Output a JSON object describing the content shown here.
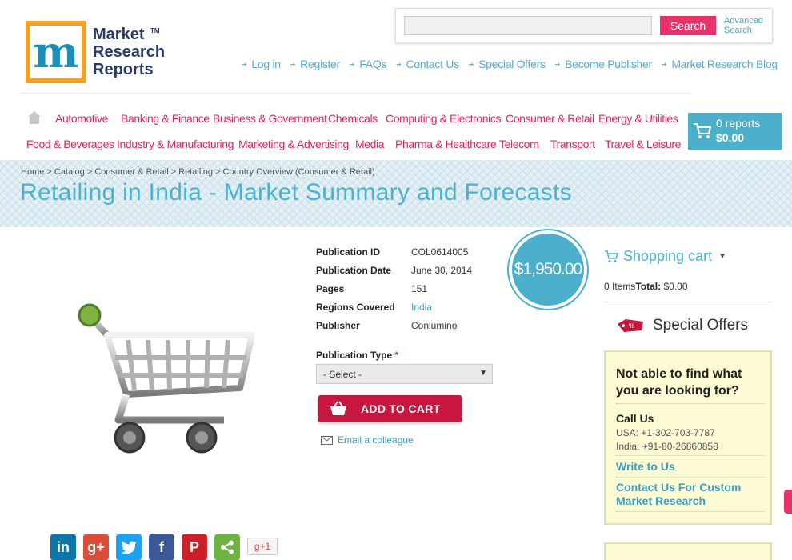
{
  "logo": {
    "lines": [
      "Market",
      "Research",
      "Reports"
    ],
    "tm": "TM"
  },
  "search": {
    "placeholder": "",
    "button": "Search",
    "advanced": [
      "Advanced",
      "Search"
    ]
  },
  "toplinks": [
    "Log in",
    "Register",
    "FAQs",
    "Contact Us",
    "Special Offers",
    "Become Publisher",
    "Market Research Blog"
  ],
  "categories_row1": [
    "Automotive",
    "Banking & Finance",
    "Business & Government",
    "Chemicals",
    "Computing & Electronics",
    "Consumer & Retail",
    "Energy & Utilities"
  ],
  "categories_row2": [
    "Food & Beverages",
    "Industry & Manufacturing",
    "Marketing & Advertising",
    "Media",
    "Pharma & Healthcare",
    "Telecom",
    "Transport",
    "Travel & Leisure"
  ],
  "cart": {
    "reports": "0 reports",
    "total": "$0.00"
  },
  "breadcrumb": "Home > Catalog > Consumer & Retail > Retailing > Country Overview (Consumer & Retail)",
  "title": "Retailing in India - Market Summary and Forecasts",
  "details": [
    {
      "key": "Publication ID",
      "value": "COL0614005",
      "link": false
    },
    {
      "key": "Publication Date",
      "value": "June 30, 2014",
      "link": false
    },
    {
      "key": "Pages",
      "value": "151",
      "link": false
    },
    {
      "key": "Regions Covered",
      "value": "India",
      "link": true
    },
    {
      "key": "Publisher",
      "value": "Conlumino",
      "link": false
    }
  ],
  "price": "$1,950.00",
  "pubtype": {
    "label": "Publication Type",
    "required": "*",
    "selected": "- Select -"
  },
  "add_to_cart": "ADD TO CART",
  "email_colleague": "Email a colleague",
  "social": {
    "gplus_one": "g+1"
  },
  "sidebar": {
    "cart_title": "Shopping cart",
    "items_label": "0 Items",
    "total_label": "Total:",
    "total_value": "$0.00",
    "special_offers": "Special Offers",
    "help_question": "Not able to find what you are looking for?",
    "call_us": "Call Us",
    "phone_usa": "USA: +1-302-703-7787",
    "phone_india": "India: +91-80-26860858",
    "write_to_us": "Write to Us",
    "contact_custom": "Contact Us For Custom Market Research"
  },
  "colors": {
    "accent": "#4cb0cd",
    "category": "#d8285e",
    "button": "#c8173f",
    "search_button": "#e8326b"
  }
}
